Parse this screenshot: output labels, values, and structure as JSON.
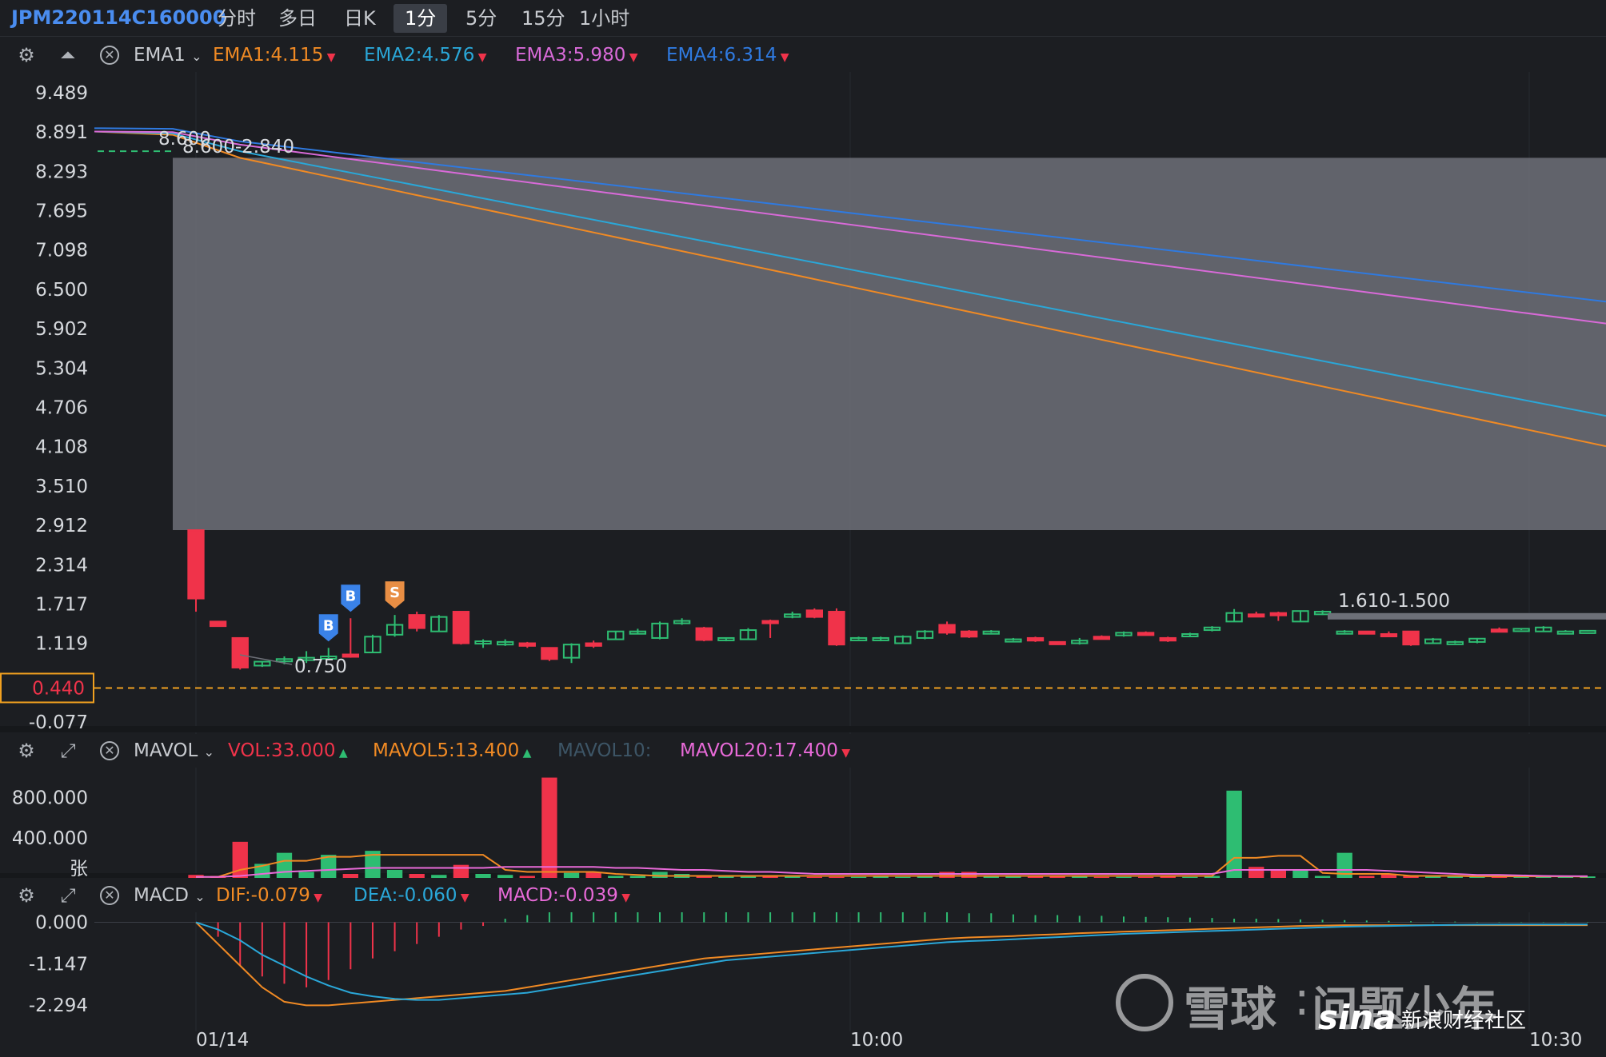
{
  "toolbar": {
    "symbol": "JPM220114C160000",
    "timeframes": [
      "分时",
      "多日",
      "日K",
      "1分",
      "5分",
      "15分",
      "1小时"
    ],
    "active": "1分"
  },
  "main_header": {
    "indicator": "EMA1",
    "items": [
      {
        "label": "EMA1:4.115",
        "color": "#f08a24"
      },
      {
        "label": "EMA2:4.576",
        "color": "#2aa7d8"
      },
      {
        "label": "EMA3:5.980",
        "color": "#d86ad8"
      },
      {
        "label": "EMA4:6.314",
        "color": "#2f7ae0"
      }
    ]
  },
  "vol_header": {
    "indicator": "MAVOL",
    "items": [
      {
        "label": "VOL:33.000",
        "color": "#f0334a",
        "arrow": "up"
      },
      {
        "label": "MAVOL5:13.400",
        "color": "#f08a24",
        "arrow": "up"
      },
      {
        "label": "MAVOL10:",
        "color": "#3d5566",
        "arrow": ""
      },
      {
        "label": "MAVOL20:17.400",
        "color": "#e86ad8",
        "arrow": "down"
      }
    ]
  },
  "macd_header": {
    "indicator": "MACD",
    "items": [
      {
        "label": "DIF:-0.079",
        "color": "#f08a24",
        "arrow": "down"
      },
      {
        "label": "DEA:-0.060",
        "color": "#2aa7d8",
        "arrow": "down"
      },
      {
        "label": "MACD:-0.039",
        "color": "#e86ad8",
        "arrow": "down"
      }
    ]
  },
  "price_axis": [
    "9.489",
    "8.891",
    "8.293",
    "7.695",
    "7.098",
    "6.500",
    "5.902",
    "5.304",
    "4.706",
    "4.108",
    "3.510",
    "2.912",
    "2.314",
    "1.717",
    "1.119",
    "0.440",
    "-0.077"
  ],
  "current_price": "0.440",
  "annotations": {
    "high_label": "8.600",
    "range_label_top": "8.600-2.840",
    "low_label": "0.750",
    "range_label_right": "1.610-1.500"
  },
  "markers": {
    "buy": "B",
    "sell": "S"
  },
  "vol_axis": [
    "800.000",
    "400.000",
    "张"
  ],
  "macd_axis": [
    "0.000",
    "-1.147",
    "-2.294"
  ],
  "time_axis": [
    "01/14",
    "10:00",
    "10:30"
  ],
  "watermark": {
    "xueqiu": "雪球",
    "sep": ":",
    "author": "问题少年",
    "sina": "sina",
    "sina_sub": "新浪财经社区"
  },
  "chart_data": {
    "type": "candlestick",
    "ylim": [
      -0.077,
      9.489
    ],
    "candles": [
      {
        "o": 2.84,
        "h": 2.84,
        "l": 1.6,
        "c": 1.8
      },
      {
        "o": 1.45,
        "h": 1.45,
        "l": 1.38,
        "c": 1.38
      },
      {
        "o": 1.2,
        "h": 1.2,
        "l": 0.72,
        "c": 0.75
      },
      {
        "o": 0.78,
        "h": 0.85,
        "l": 0.76,
        "c": 0.84
      },
      {
        "o": 0.86,
        "h": 0.92,
        "l": 0.8,
        "c": 0.88
      },
      {
        "o": 0.88,
        "h": 1.0,
        "l": 0.82,
        "c": 0.9
      },
      {
        "o": 0.9,
        "h": 1.05,
        "l": 0.88,
        "c": 0.92
      },
      {
        "o": 0.95,
        "h": 1.5,
        "l": 0.9,
        "c": 0.93
      },
      {
        "o": 0.98,
        "h": 1.25,
        "l": 0.98,
        "c": 1.22
      },
      {
        "o": 1.25,
        "h": 1.55,
        "l": 1.22,
        "c": 1.4
      },
      {
        "o": 1.55,
        "h": 1.6,
        "l": 1.3,
        "c": 1.35
      },
      {
        "o": 1.3,
        "h": 1.55,
        "l": 1.3,
        "c": 1.52
      },
      {
        "o": 1.6,
        "h": 1.6,
        "l": 1.1,
        "c": 1.12
      },
      {
        "o": 1.12,
        "h": 1.18,
        "l": 1.05,
        "c": 1.15
      },
      {
        "o": 1.1,
        "h": 1.18,
        "l": 1.08,
        "c": 1.14
      },
      {
        "o": 1.12,
        "h": 1.14,
        "l": 1.05,
        "c": 1.08
      },
      {
        "o": 1.05,
        "h": 1.05,
        "l": 0.85,
        "c": 0.88
      },
      {
        "o": 0.9,
        "h": 1.12,
        "l": 0.82,
        "c": 1.1
      },
      {
        "o": 1.12,
        "h": 1.16,
        "l": 1.05,
        "c": 1.08
      },
      {
        "o": 1.18,
        "h": 1.3,
        "l": 1.18,
        "c": 1.3
      },
      {
        "o": 1.28,
        "h": 1.34,
        "l": 1.26,
        "c": 1.3
      },
      {
        "o": 1.2,
        "h": 1.45,
        "l": 1.18,
        "c": 1.42
      },
      {
        "o": 1.45,
        "h": 1.5,
        "l": 1.4,
        "c": 1.46
      },
      {
        "o": 1.35,
        "h": 1.37,
        "l": 1.15,
        "c": 1.17
      },
      {
        "o": 1.17,
        "h": 1.2,
        "l": 1.15,
        "c": 1.2
      },
      {
        "o": 1.18,
        "h": 1.35,
        "l": 1.18,
        "c": 1.32
      },
      {
        "o": 1.46,
        "h": 1.48,
        "l": 1.2,
        "c": 1.44
      },
      {
        "o": 1.52,
        "h": 1.6,
        "l": 1.5,
        "c": 1.56
      },
      {
        "o": 1.62,
        "h": 1.65,
        "l": 1.5,
        "c": 1.52
      },
      {
        "o": 1.6,
        "h": 1.65,
        "l": 1.08,
        "c": 1.1
      },
      {
        "o": 1.2,
        "h": 1.22,
        "l": 1.18,
        "c": 1.2
      },
      {
        "o": 1.18,
        "h": 1.22,
        "l": 1.15,
        "c": 1.2
      },
      {
        "o": 1.12,
        "h": 1.24,
        "l": 1.12,
        "c": 1.22
      },
      {
        "o": 1.2,
        "h": 1.32,
        "l": 1.18,
        "c": 1.3
      },
      {
        "o": 1.4,
        "h": 1.45,
        "l": 1.25,
        "c": 1.28
      },
      {
        "o": 1.3,
        "h": 1.32,
        "l": 1.2,
        "c": 1.22
      },
      {
        "o": 1.3,
        "h": 1.32,
        "l": 1.28,
        "c": 1.3
      },
      {
        "o": 1.18,
        "h": 1.2,
        "l": 1.16,
        "c": 1.18
      },
      {
        "o": 1.2,
        "h": 1.22,
        "l": 1.14,
        "c": 1.16
      },
      {
        "o": 1.14,
        "h": 1.15,
        "l": 1.1,
        "c": 1.12
      },
      {
        "o": 1.12,
        "h": 1.2,
        "l": 1.1,
        "c": 1.16
      },
      {
        "o": 1.22,
        "h": 1.24,
        "l": 1.18,
        "c": 1.2
      },
      {
        "o": 1.24,
        "h": 1.3,
        "l": 1.22,
        "c": 1.28
      },
      {
        "o": 1.28,
        "h": 1.3,
        "l": 1.24,
        "c": 1.25
      },
      {
        "o": 1.2,
        "h": 1.22,
        "l": 1.14,
        "c": 1.16
      },
      {
        "o": 1.24,
        "h": 1.28,
        "l": 1.22,
        "c": 1.26
      },
      {
        "o": 1.32,
        "h": 1.38,
        "l": 1.3,
        "c": 1.36
      },
      {
        "o": 1.45,
        "h": 1.64,
        "l": 1.45,
        "c": 1.58
      },
      {
        "o": 1.56,
        "h": 1.6,
        "l": 1.52,
        "c": 1.54
      },
      {
        "o": 1.58,
        "h": 1.6,
        "l": 1.46,
        "c": 1.56
      },
      {
        "o": 1.45,
        "h": 1.62,
        "l": 1.45,
        "c": 1.61
      },
      {
        "o": 1.56,
        "h": 1.62,
        "l": 1.55,
        "c": 1.6
      },
      {
        "o": 1.3,
        "h": 1.32,
        "l": 1.28,
        "c": 1.3
      },
      {
        "o": 1.3,
        "h": 1.3,
        "l": 1.28,
        "c": 1.28
      },
      {
        "o": 1.26,
        "h": 1.3,
        "l": 1.22,
        "c": 1.24
      },
      {
        "o": 1.3,
        "h": 1.3,
        "l": 1.08,
        "c": 1.1
      },
      {
        "o": 1.12,
        "h": 1.2,
        "l": 1.12,
        "c": 1.18
      },
      {
        "o": 1.14,
        "h": 1.16,
        "l": 1.12,
        "c": 1.14
      },
      {
        "o": 1.14,
        "h": 1.2,
        "l": 1.12,
        "c": 1.19
      },
      {
        "o": 1.33,
        "h": 1.36,
        "l": 1.3,
        "c": 1.31
      },
      {
        "o": 1.32,
        "h": 1.34,
        "l": 1.32,
        "c": 1.34
      },
      {
        "o": 1.3,
        "h": 1.38,
        "l": 1.3,
        "c": 1.36
      },
      {
        "o": 1.3,
        "h": 1.32,
        "l": 1.3,
        "c": 1.3
      },
      {
        "o": 1.3,
        "h": 1.32,
        "l": 1.3,
        "c": 1.31
      }
    ],
    "volume": [
      30,
      20,
      360,
      140,
      250,
      60,
      230,
      40,
      270,
      80,
      40,
      30,
      130,
      40,
      30,
      20,
      1000,
      50,
      60,
      20,
      20,
      60,
      40,
      20,
      20,
      15,
      20,
      15,
      10,
      10,
      10,
      15,
      10,
      20,
      60,
      60,
      20,
      20,
      20,
      20,
      20,
      10,
      10,
      10,
      20,
      10,
      20,
      870,
      110,
      80,
      80,
      20,
      250,
      20,
      40,
      20,
      20,
      20,
      15,
      15,
      15,
      15,
      15,
      15
    ],
    "mavol5": [
      10,
      10,
      80,
      120,
      170,
      170,
      210,
      210,
      230,
      230,
      230,
      230,
      230,
      230,
      80,
      60,
      60,
      60,
      60,
      40,
      30,
      20,
      20,
      20,
      20,
      20,
      20,
      20,
      20,
      20,
      20,
      20,
      20,
      20,
      20,
      20,
      20,
      20,
      20,
      20,
      20,
      20,
      20,
      20,
      20,
      20,
      20,
      200,
      200,
      220,
      220,
      50,
      40,
      40,
      40,
      20,
      20,
      20,
      15,
      15,
      15,
      15,
      15,
      13.4
    ],
    "mavol20": [
      10,
      10,
      20,
      40,
      60,
      70,
      80,
      90,
      100,
      100,
      100,
      100,
      100,
      100,
      110,
      110,
      110,
      110,
      110,
      100,
      100,
      90,
      80,
      80,
      70,
      60,
      60,
      50,
      40,
      40,
      40,
      40,
      40,
      40,
      40,
      40,
      40,
      40,
      40,
      40,
      40,
      40,
      40,
      40,
      40,
      40,
      40,
      80,
      80,
      80,
      80,
      80,
      80,
      80,
      70,
      60,
      50,
      40,
      30,
      30,
      25,
      20,
      18,
      17.4
    ],
    "vol_ylim": [
      0,
      1100
    ],
    "macd_hist": [
      0,
      -0.4,
      -1.2,
      -1.5,
      -1.7,
      -1.8,
      -1.6,
      -1.3,
      -1.0,
      -0.8,
      -0.6,
      -0.4,
      -0.2,
      -0.1,
      0.1,
      0.2,
      0.3,
      0.35,
      0.4,
      0.45,
      0.5,
      0.5,
      0.5,
      0.5,
      0.5,
      0.45,
      0.45,
      0.45,
      0.4,
      0.4,
      0.35,
      0.35,
      0.3,
      0.3,
      0.28,
      0.25,
      0.25,
      0.22,
      0.2,
      0.2,
      0.18,
      0.18,
      0.16,
      0.15,
      0.14,
      0.13,
      0.12,
      0.1,
      0.1,
      0.09,
      0.08,
      0.07,
      0.06,
      0.05,
      0.04,
      0.03,
      0.02,
      0.02,
      0.01,
      0.01,
      0.01,
      0.01,
      0.01,
      0.01
    ],
    "dif": [
      0,
      -0.6,
      -1.2,
      -1.8,
      -2.2,
      -2.3,
      -2.3,
      -2.25,
      -2.2,
      -2.15,
      -2.1,
      -2.05,
      -2.0,
      -1.95,
      -1.9,
      -1.8,
      -1.7,
      -1.6,
      -1.5,
      -1.4,
      -1.3,
      -1.2,
      -1.1,
      -1.0,
      -0.95,
      -0.9,
      -0.85,
      -0.8,
      -0.75,
      -0.7,
      -0.65,
      -0.6,
      -0.55,
      -0.5,
      -0.45,
      -0.42,
      -0.4,
      -0.38,
      -0.35,
      -0.33,
      -0.3,
      -0.28,
      -0.26,
      -0.24,
      -0.22,
      -0.2,
      -0.18,
      -0.16,
      -0.14,
      -0.12,
      -0.1,
      -0.09,
      -0.08,
      -0.08,
      -0.08,
      -0.08,
      -0.08,
      -0.08,
      -0.08,
      -0.079,
      -0.079,
      -0.079,
      -0.079,
      -0.079
    ],
    "dea": [
      0,
      -0.2,
      -0.5,
      -0.9,
      -1.2,
      -1.5,
      -1.75,
      -1.95,
      -2.05,
      -2.12,
      -2.15,
      -2.15,
      -2.1,
      -2.05,
      -2.0,
      -1.95,
      -1.85,
      -1.75,
      -1.65,
      -1.55,
      -1.45,
      -1.35,
      -1.25,
      -1.15,
      -1.05,
      -1.0,
      -0.95,
      -0.9,
      -0.85,
      -0.8,
      -0.75,
      -0.7,
      -0.65,
      -0.6,
      -0.55,
      -0.52,
      -0.5,
      -0.47,
      -0.44,
      -0.41,
      -0.38,
      -0.35,
      -0.32,
      -0.3,
      -0.28,
      -0.26,
      -0.24,
      -0.22,
      -0.2,
      -0.18,
      -0.16,
      -0.14,
      -0.12,
      -0.11,
      -0.1,
      -0.09,
      -0.08,
      -0.07,
      -0.065,
      -0.062,
      -0.061,
      -0.06,
      -0.06,
      -0.06
    ],
    "macd_ylim": [
      -2.8,
      0.3
    ],
    "ema_lines": [
      {
        "name": "EMA1",
        "color": "#f08a24",
        "values": [
          8.9,
          8.85,
          8.5,
          4.115
        ]
      },
      {
        "name": "EMA2",
        "color": "#2aa7d8",
        "values": [
          8.9,
          8.87,
          8.6,
          4.576
        ]
      },
      {
        "name": "EMA3",
        "color": "#d86ad8",
        "values": [
          8.9,
          8.89,
          8.7,
          5.98
        ]
      },
      {
        "name": "EMA4",
        "color": "#2f7ae0",
        "values": [
          8.95,
          8.94,
          8.75,
          6.314
        ]
      }
    ],
    "range_box": {
      "top": 8.5,
      "bottom": 2.84
    }
  }
}
